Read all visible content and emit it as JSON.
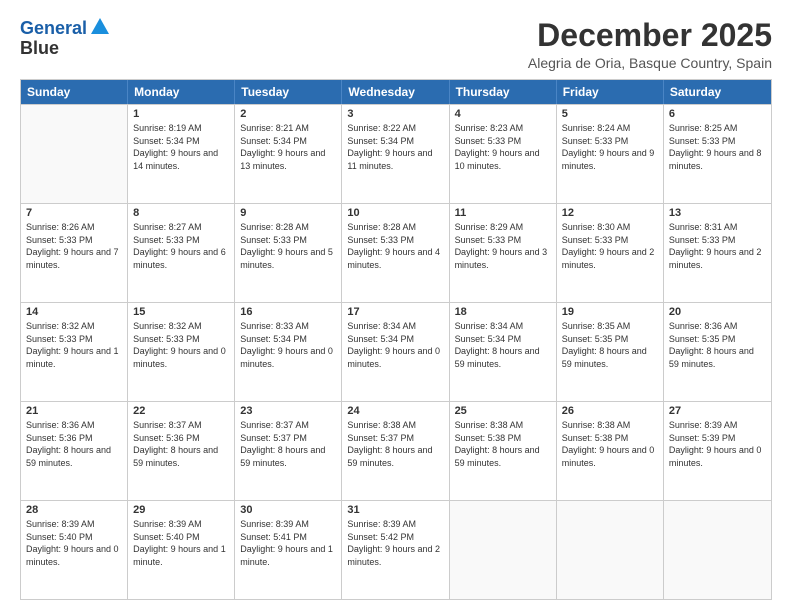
{
  "logo": {
    "line1": "General",
    "line2": "Blue"
  },
  "title": "December 2025",
  "location": "Alegria de Oria, Basque Country, Spain",
  "weekdays": [
    "Sunday",
    "Monday",
    "Tuesday",
    "Wednesday",
    "Thursday",
    "Friday",
    "Saturday"
  ],
  "weeks": [
    [
      {
        "day": "",
        "sunrise": "",
        "sunset": "",
        "daylight": ""
      },
      {
        "day": "1",
        "sunrise": "Sunrise: 8:19 AM",
        "sunset": "Sunset: 5:34 PM",
        "daylight": "Daylight: 9 hours and 14 minutes."
      },
      {
        "day": "2",
        "sunrise": "Sunrise: 8:21 AM",
        "sunset": "Sunset: 5:34 PM",
        "daylight": "Daylight: 9 hours and 13 minutes."
      },
      {
        "day": "3",
        "sunrise": "Sunrise: 8:22 AM",
        "sunset": "Sunset: 5:34 PM",
        "daylight": "Daylight: 9 hours and 11 minutes."
      },
      {
        "day": "4",
        "sunrise": "Sunrise: 8:23 AM",
        "sunset": "Sunset: 5:33 PM",
        "daylight": "Daylight: 9 hours and 10 minutes."
      },
      {
        "day": "5",
        "sunrise": "Sunrise: 8:24 AM",
        "sunset": "Sunset: 5:33 PM",
        "daylight": "Daylight: 9 hours and 9 minutes."
      },
      {
        "day": "6",
        "sunrise": "Sunrise: 8:25 AM",
        "sunset": "Sunset: 5:33 PM",
        "daylight": "Daylight: 9 hours and 8 minutes."
      }
    ],
    [
      {
        "day": "7",
        "sunrise": "Sunrise: 8:26 AM",
        "sunset": "Sunset: 5:33 PM",
        "daylight": "Daylight: 9 hours and 7 minutes."
      },
      {
        "day": "8",
        "sunrise": "Sunrise: 8:27 AM",
        "sunset": "Sunset: 5:33 PM",
        "daylight": "Daylight: 9 hours and 6 minutes."
      },
      {
        "day": "9",
        "sunrise": "Sunrise: 8:28 AM",
        "sunset": "Sunset: 5:33 PM",
        "daylight": "Daylight: 9 hours and 5 minutes."
      },
      {
        "day": "10",
        "sunrise": "Sunrise: 8:28 AM",
        "sunset": "Sunset: 5:33 PM",
        "daylight": "Daylight: 9 hours and 4 minutes."
      },
      {
        "day": "11",
        "sunrise": "Sunrise: 8:29 AM",
        "sunset": "Sunset: 5:33 PM",
        "daylight": "Daylight: 9 hours and 3 minutes."
      },
      {
        "day": "12",
        "sunrise": "Sunrise: 8:30 AM",
        "sunset": "Sunset: 5:33 PM",
        "daylight": "Daylight: 9 hours and 2 minutes."
      },
      {
        "day": "13",
        "sunrise": "Sunrise: 8:31 AM",
        "sunset": "Sunset: 5:33 PM",
        "daylight": "Daylight: 9 hours and 2 minutes."
      }
    ],
    [
      {
        "day": "14",
        "sunrise": "Sunrise: 8:32 AM",
        "sunset": "Sunset: 5:33 PM",
        "daylight": "Daylight: 9 hours and 1 minute."
      },
      {
        "day": "15",
        "sunrise": "Sunrise: 8:32 AM",
        "sunset": "Sunset: 5:33 PM",
        "daylight": "Daylight: 9 hours and 0 minutes."
      },
      {
        "day": "16",
        "sunrise": "Sunrise: 8:33 AM",
        "sunset": "Sunset: 5:34 PM",
        "daylight": "Daylight: 9 hours and 0 minutes."
      },
      {
        "day": "17",
        "sunrise": "Sunrise: 8:34 AM",
        "sunset": "Sunset: 5:34 PM",
        "daylight": "Daylight: 9 hours and 0 minutes."
      },
      {
        "day": "18",
        "sunrise": "Sunrise: 8:34 AM",
        "sunset": "Sunset: 5:34 PM",
        "daylight": "Daylight: 8 hours and 59 minutes."
      },
      {
        "day": "19",
        "sunrise": "Sunrise: 8:35 AM",
        "sunset": "Sunset: 5:35 PM",
        "daylight": "Daylight: 8 hours and 59 minutes."
      },
      {
        "day": "20",
        "sunrise": "Sunrise: 8:36 AM",
        "sunset": "Sunset: 5:35 PM",
        "daylight": "Daylight: 8 hours and 59 minutes."
      }
    ],
    [
      {
        "day": "21",
        "sunrise": "Sunrise: 8:36 AM",
        "sunset": "Sunset: 5:36 PM",
        "daylight": "Daylight: 8 hours and 59 minutes."
      },
      {
        "day": "22",
        "sunrise": "Sunrise: 8:37 AM",
        "sunset": "Sunset: 5:36 PM",
        "daylight": "Daylight: 8 hours and 59 minutes."
      },
      {
        "day": "23",
        "sunrise": "Sunrise: 8:37 AM",
        "sunset": "Sunset: 5:37 PM",
        "daylight": "Daylight: 8 hours and 59 minutes."
      },
      {
        "day": "24",
        "sunrise": "Sunrise: 8:38 AM",
        "sunset": "Sunset: 5:37 PM",
        "daylight": "Daylight: 8 hours and 59 minutes."
      },
      {
        "day": "25",
        "sunrise": "Sunrise: 8:38 AM",
        "sunset": "Sunset: 5:38 PM",
        "daylight": "Daylight: 8 hours and 59 minutes."
      },
      {
        "day": "26",
        "sunrise": "Sunrise: 8:38 AM",
        "sunset": "Sunset: 5:38 PM",
        "daylight": "Daylight: 9 hours and 0 minutes."
      },
      {
        "day": "27",
        "sunrise": "Sunrise: 8:39 AM",
        "sunset": "Sunset: 5:39 PM",
        "daylight": "Daylight: 9 hours and 0 minutes."
      }
    ],
    [
      {
        "day": "28",
        "sunrise": "Sunrise: 8:39 AM",
        "sunset": "Sunset: 5:40 PM",
        "daylight": "Daylight: 9 hours and 0 minutes."
      },
      {
        "day": "29",
        "sunrise": "Sunrise: 8:39 AM",
        "sunset": "Sunset: 5:40 PM",
        "daylight": "Daylight: 9 hours and 1 minute."
      },
      {
        "day": "30",
        "sunrise": "Sunrise: 8:39 AM",
        "sunset": "Sunset: 5:41 PM",
        "daylight": "Daylight: 9 hours and 1 minute."
      },
      {
        "day": "31",
        "sunrise": "Sunrise: 8:39 AM",
        "sunset": "Sunset: 5:42 PM",
        "daylight": "Daylight: 9 hours and 2 minutes."
      },
      {
        "day": "",
        "sunrise": "",
        "sunset": "",
        "daylight": ""
      },
      {
        "day": "",
        "sunrise": "",
        "sunset": "",
        "daylight": ""
      },
      {
        "day": "",
        "sunrise": "",
        "sunset": "",
        "daylight": ""
      }
    ]
  ]
}
